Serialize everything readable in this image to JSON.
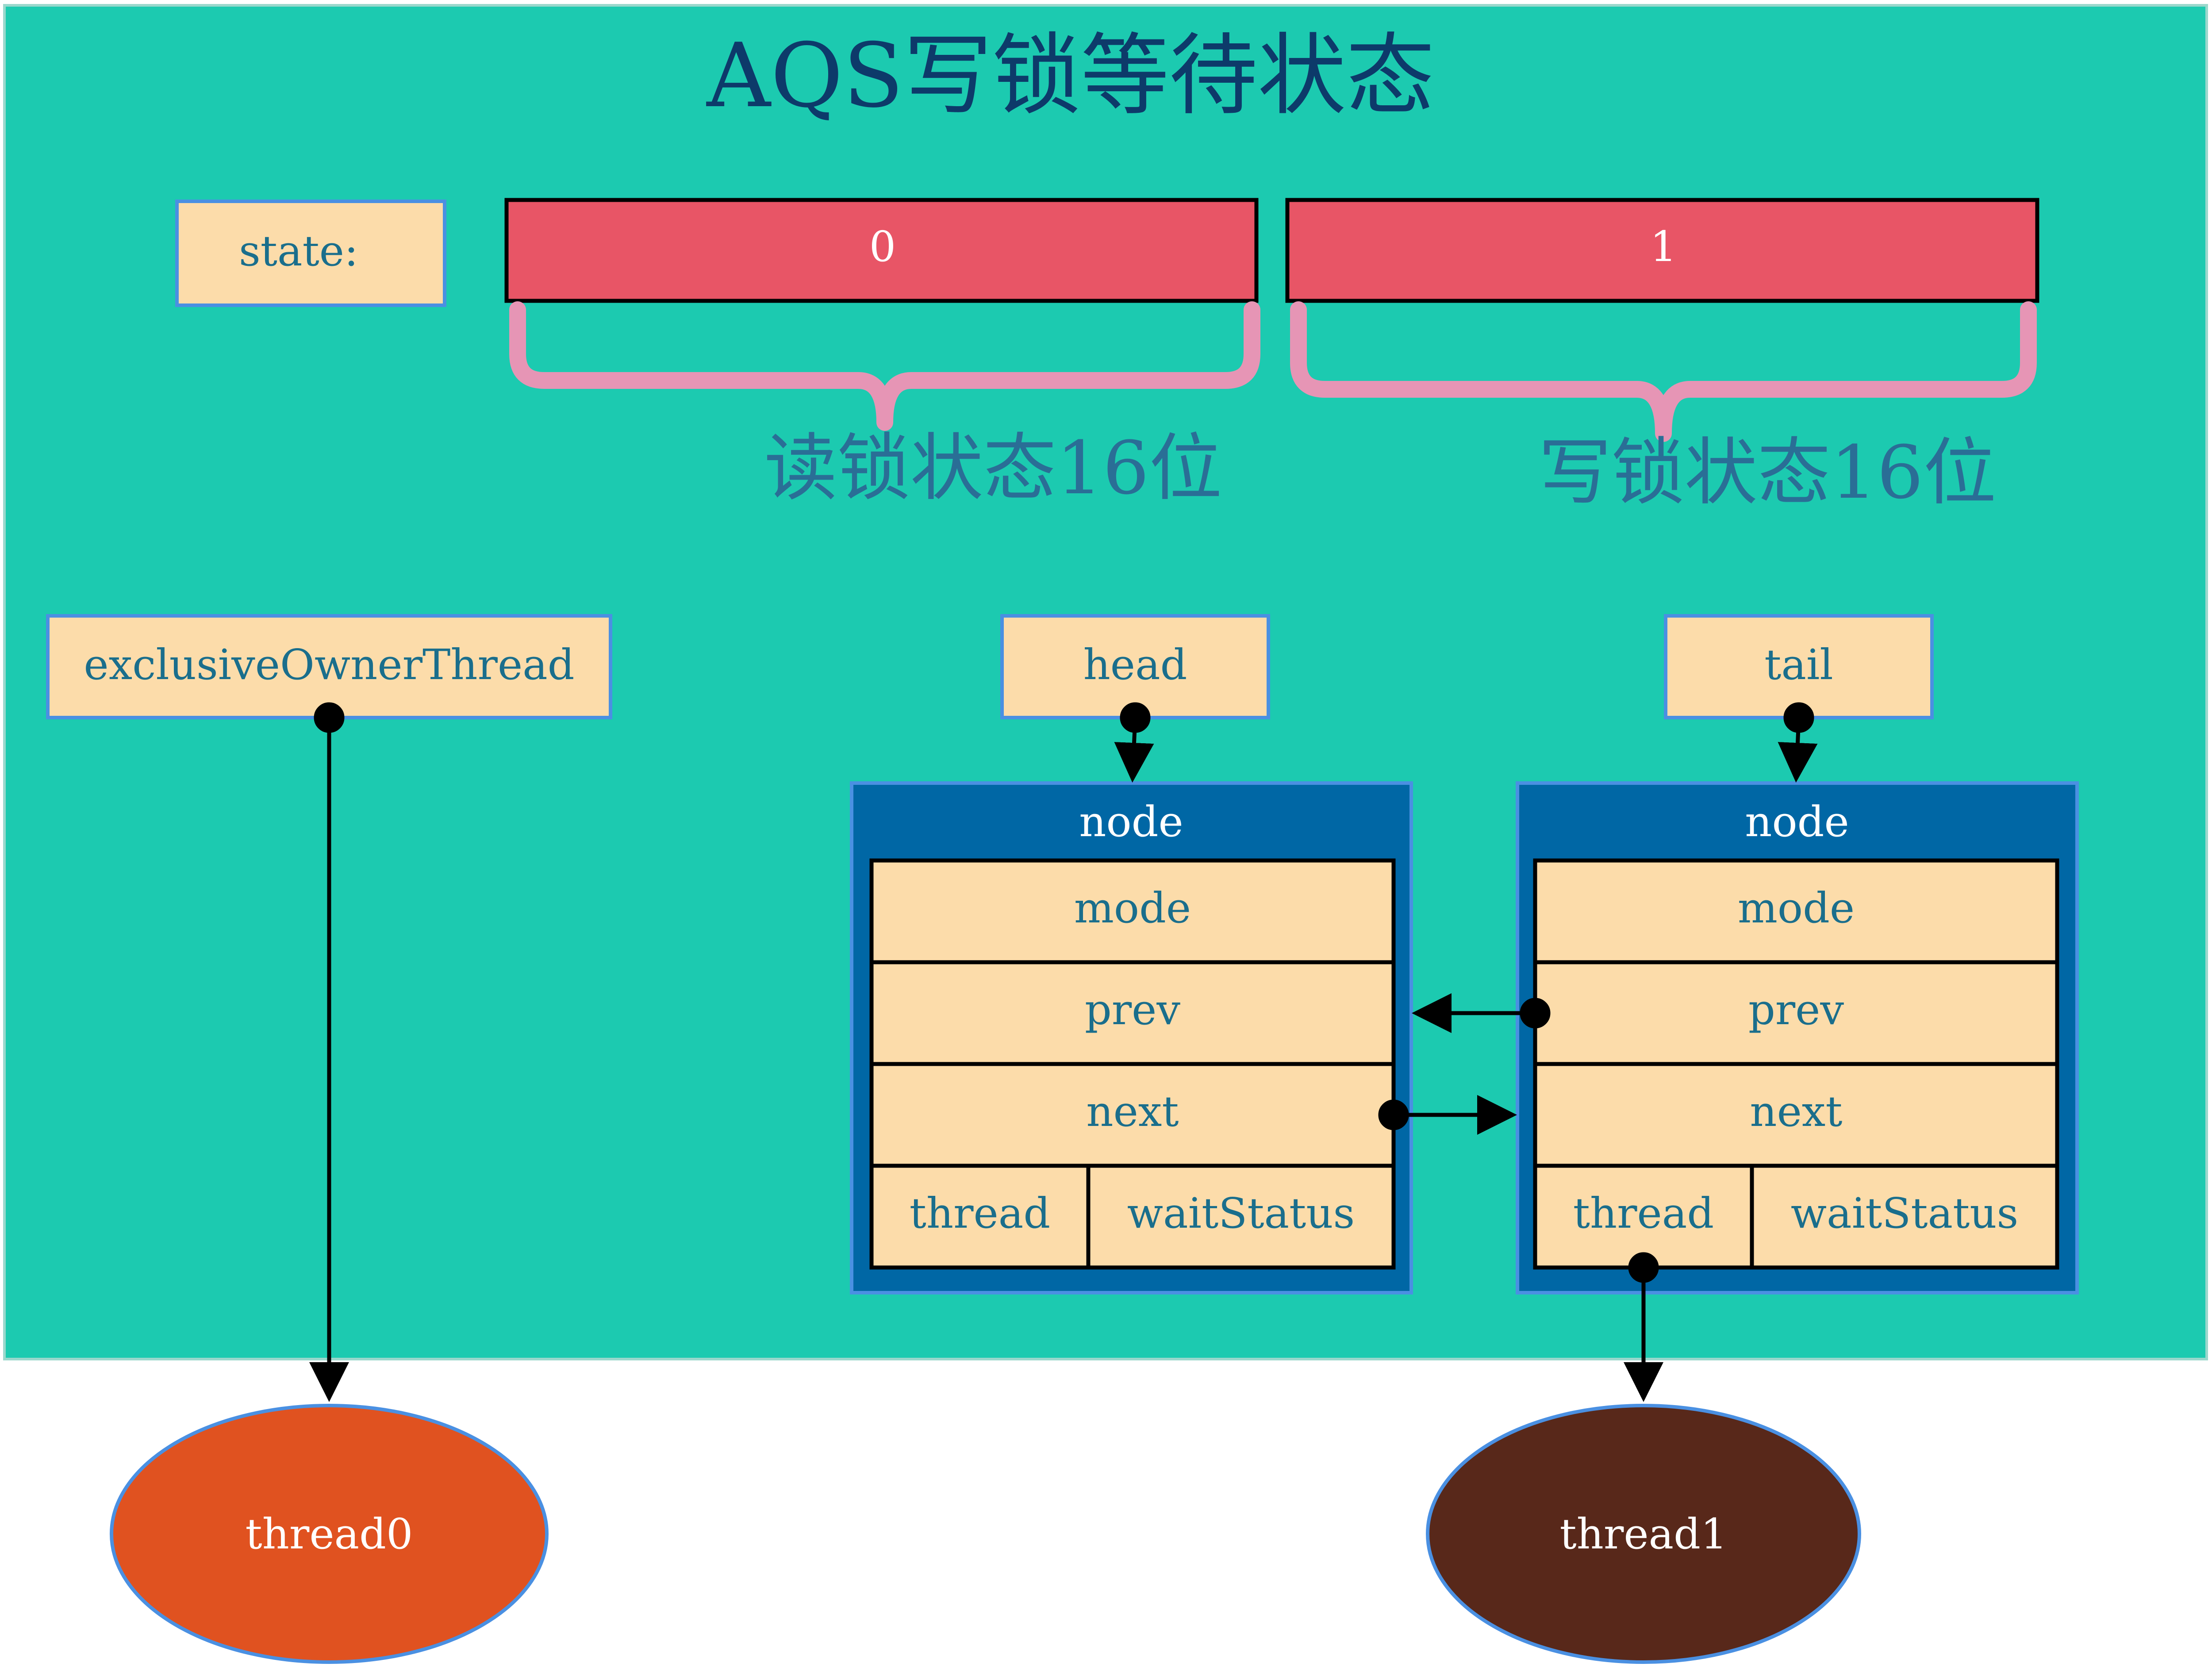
{
  "title": "AQS写锁等待状态",
  "state": {
    "label": "state:",
    "read_bits_value": "0",
    "write_bits_value": "1",
    "read_brace_label": "读锁状态16位",
    "write_brace_label": "写锁状态16位"
  },
  "fields": {
    "exclusive_owner": "exclusiveOwnerThread",
    "head": "head",
    "tail": "tail"
  },
  "nodes": [
    {
      "title": "node",
      "mode": "mode",
      "prev": "prev",
      "next": "next",
      "thread": "thread",
      "wait_status": "waitStatus"
    },
    {
      "title": "node",
      "mode": "mode",
      "prev": "prev",
      "next": "next",
      "thread": "thread",
      "wait_status": "waitStatus"
    }
  ],
  "threads": {
    "owner": "thread0",
    "waiting": "thread1"
  },
  "colors": {
    "background": "#1ccab0",
    "field_box": "#fcdcaa",
    "field_text": "#1a6e8c",
    "state_bar": "#e85566",
    "brace": "#e695b5",
    "node_frame": "#0067a5",
    "thread0": "#e05220",
    "thread1": "#58281a",
    "title_text": "#0d3a6a"
  }
}
